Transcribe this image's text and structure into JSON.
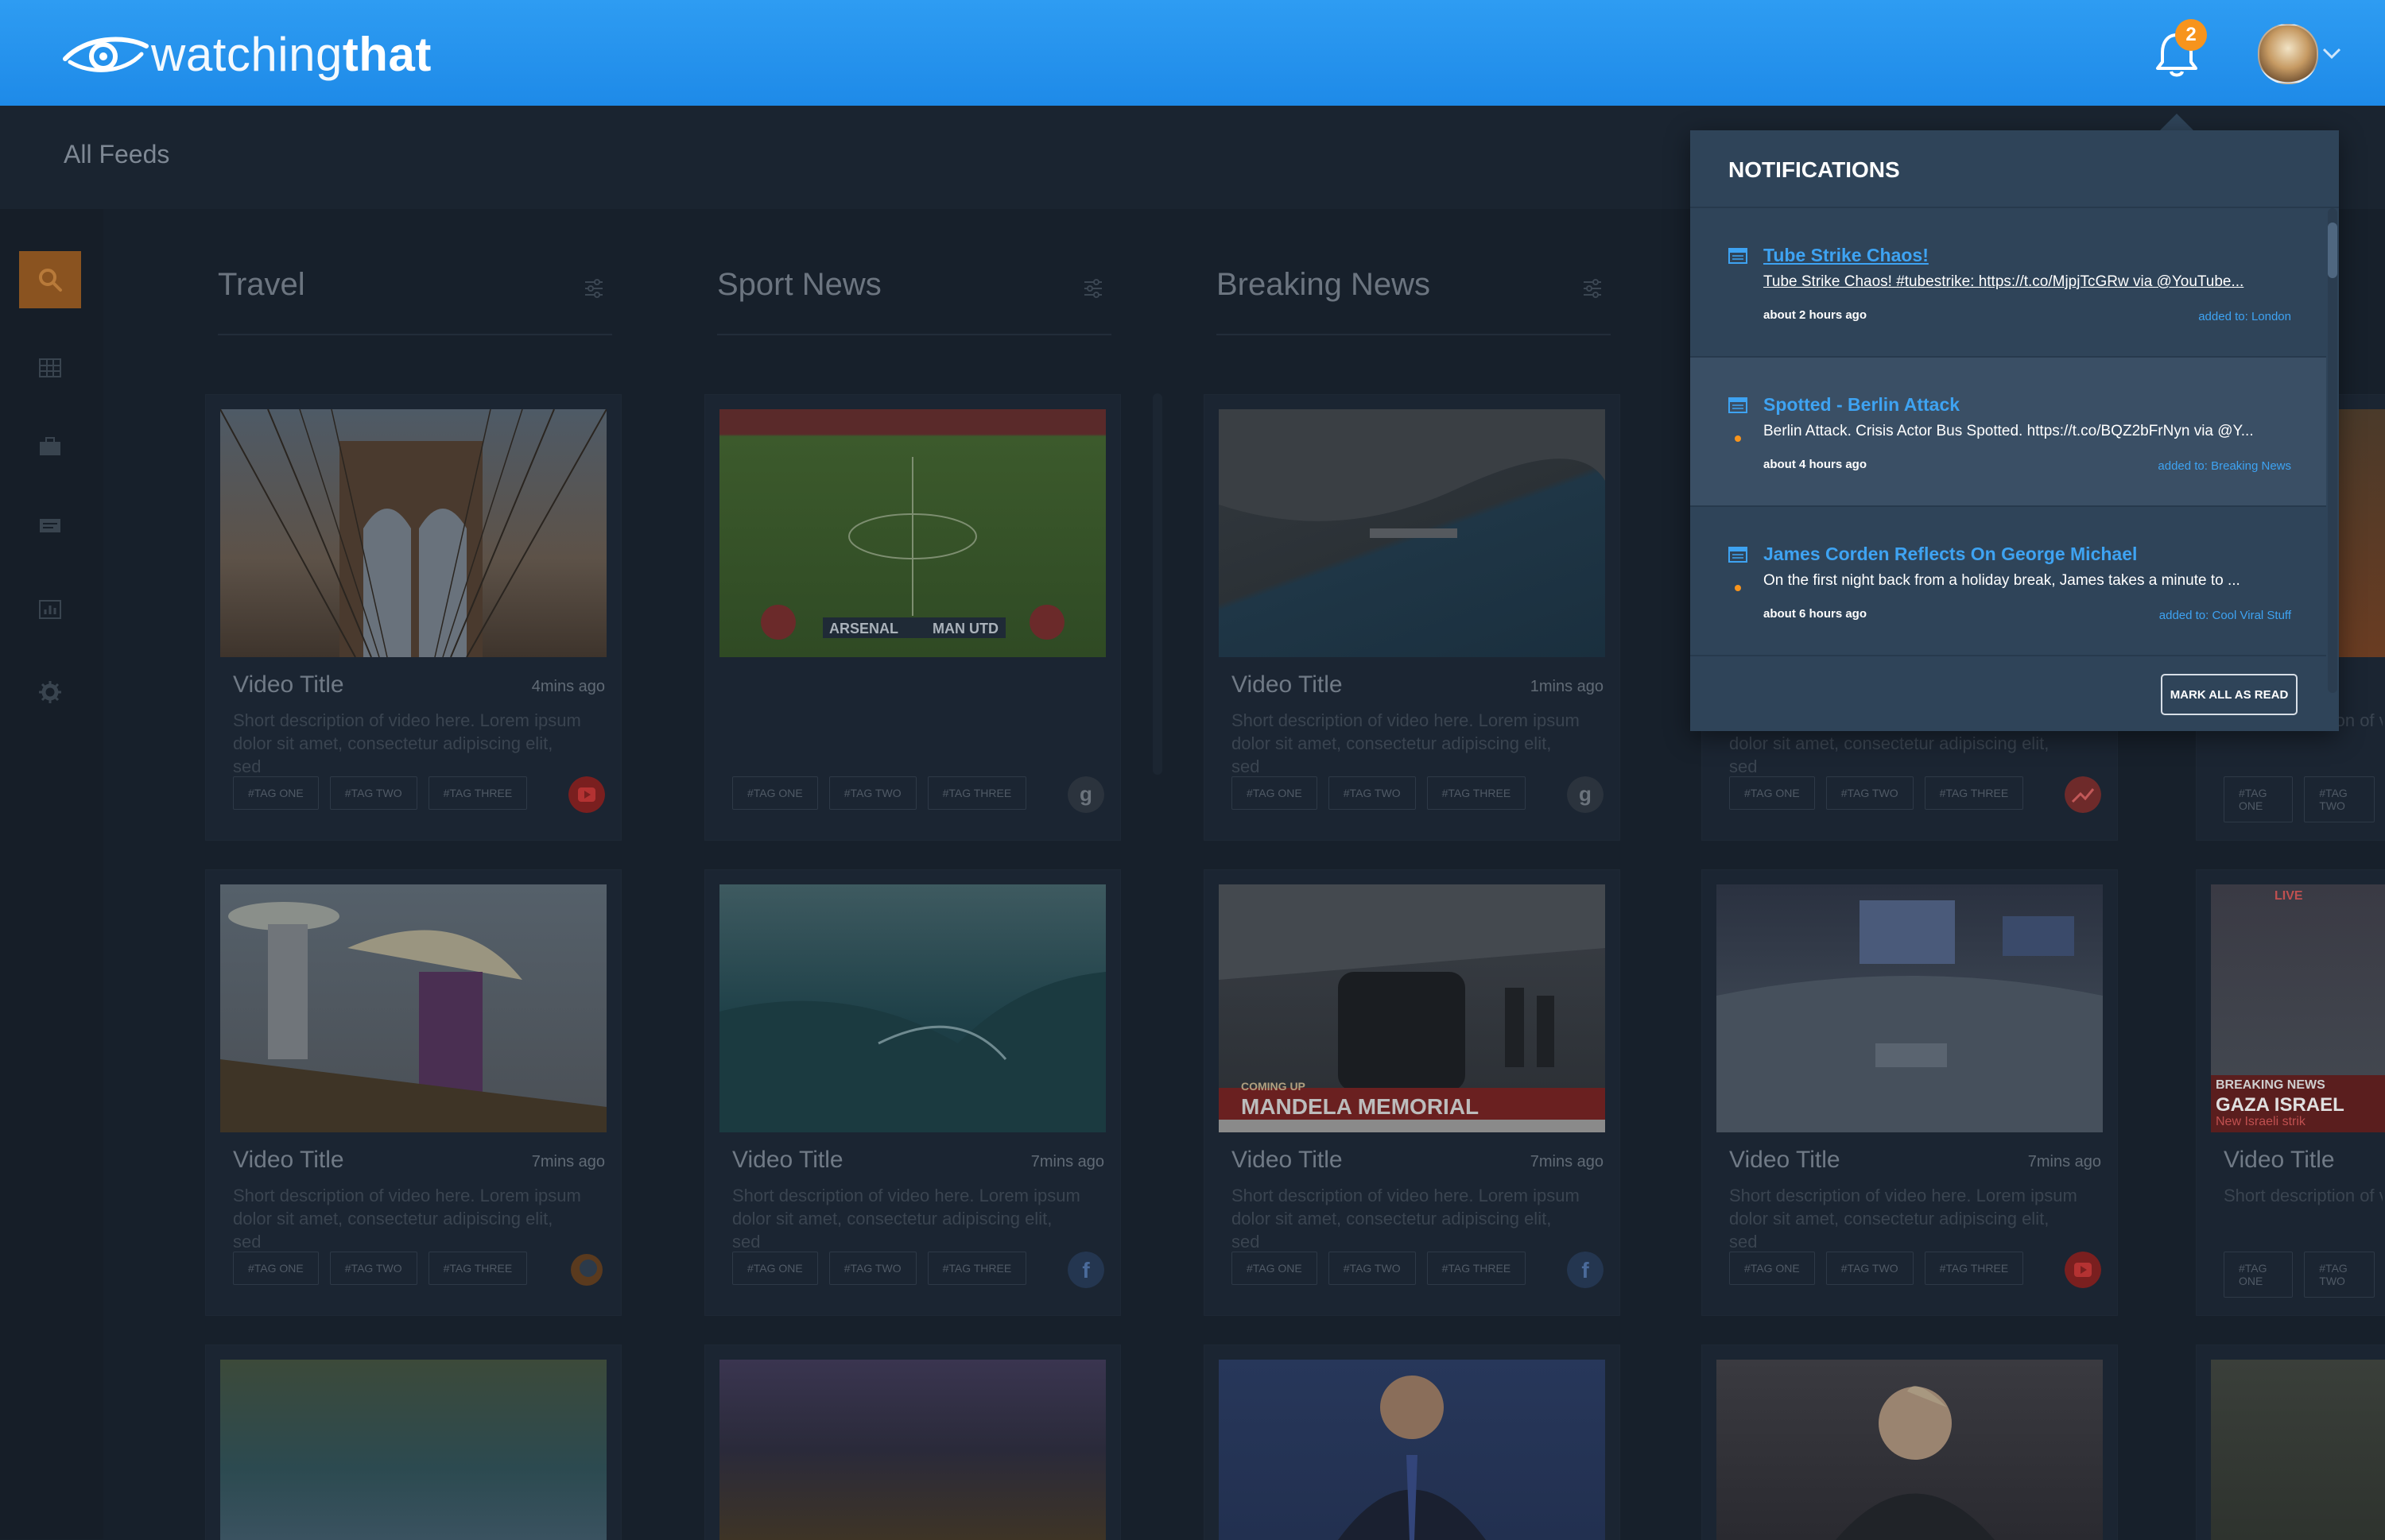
{
  "app": {
    "brand_light": "watching",
    "brand_bold": "that",
    "notification_count": "2"
  },
  "page": {
    "title": "All Feeds"
  },
  "sidebar": {
    "items": [
      {
        "icon": "search-icon",
        "active": true
      },
      {
        "icon": "grid-icon"
      },
      {
        "icon": "briefcase-icon"
      },
      {
        "icon": "message-icon"
      },
      {
        "icon": "bar-chart-icon"
      },
      {
        "icon": "gear-icon"
      }
    ]
  },
  "columns": [
    {
      "title": "Travel"
    },
    {
      "title": "Sport News"
    },
    {
      "title": "Breaking News"
    }
  ],
  "card_text": {
    "video_title": "Video Title",
    "description": "Short description of video here. Lorem ipsum dolor sit amet, consectetur adipiscing elit, sed",
    "tags": [
      "#TAG ONE",
      "#TAG TWO",
      "#TAG THREE"
    ],
    "times": {
      "t4": "4mins ago",
      "t1": "1mins ago",
      "t7": "7mins ago"
    }
  },
  "thumb_captions": {
    "arsenal": "ARSENAL",
    "manutd": "MAN UTD",
    "mandela_small": "COMING UP",
    "mandela": "MANDELA MEMORIAL",
    "live": "LIVE",
    "breaking": "BREAKING NEWS",
    "gaza": "GAZA ISRAEL",
    "gaza_sub": "New Israeli strik"
  },
  "notifications": {
    "title": "NOTIFICATIONS",
    "items": [
      {
        "title": "Tube Strike Chaos!",
        "text": "Tube Strike Chaos! #tubestrike: https://t.co/MjpjTcGRw via @YouTube...",
        "time": "about 2 hours ago",
        "added": "added to: London"
      },
      {
        "title": "Spotted - Berlin Attack",
        "text": "Berlin Attack. Crisis Actor Bus Spotted. https://t.co/BQZ2bFrNyn via @Y...",
        "time": "about 4 hours ago",
        "added": "added to: Breaking News"
      },
      {
        "title": "James Corden Reflects On George Michael",
        "text": "On the first night back from a holiday break, James takes a minute to ...",
        "time": "about 6 hours ago",
        "added": "added to: Cool Viral Stuff"
      }
    ],
    "mark_all_label": "MARK ALL AS READ"
  },
  "colors": {
    "topbar": "#1e8ae8",
    "accent_orange": "#f7941d",
    "link_blue": "#3ea3f2",
    "panel": "#2f4459"
  }
}
